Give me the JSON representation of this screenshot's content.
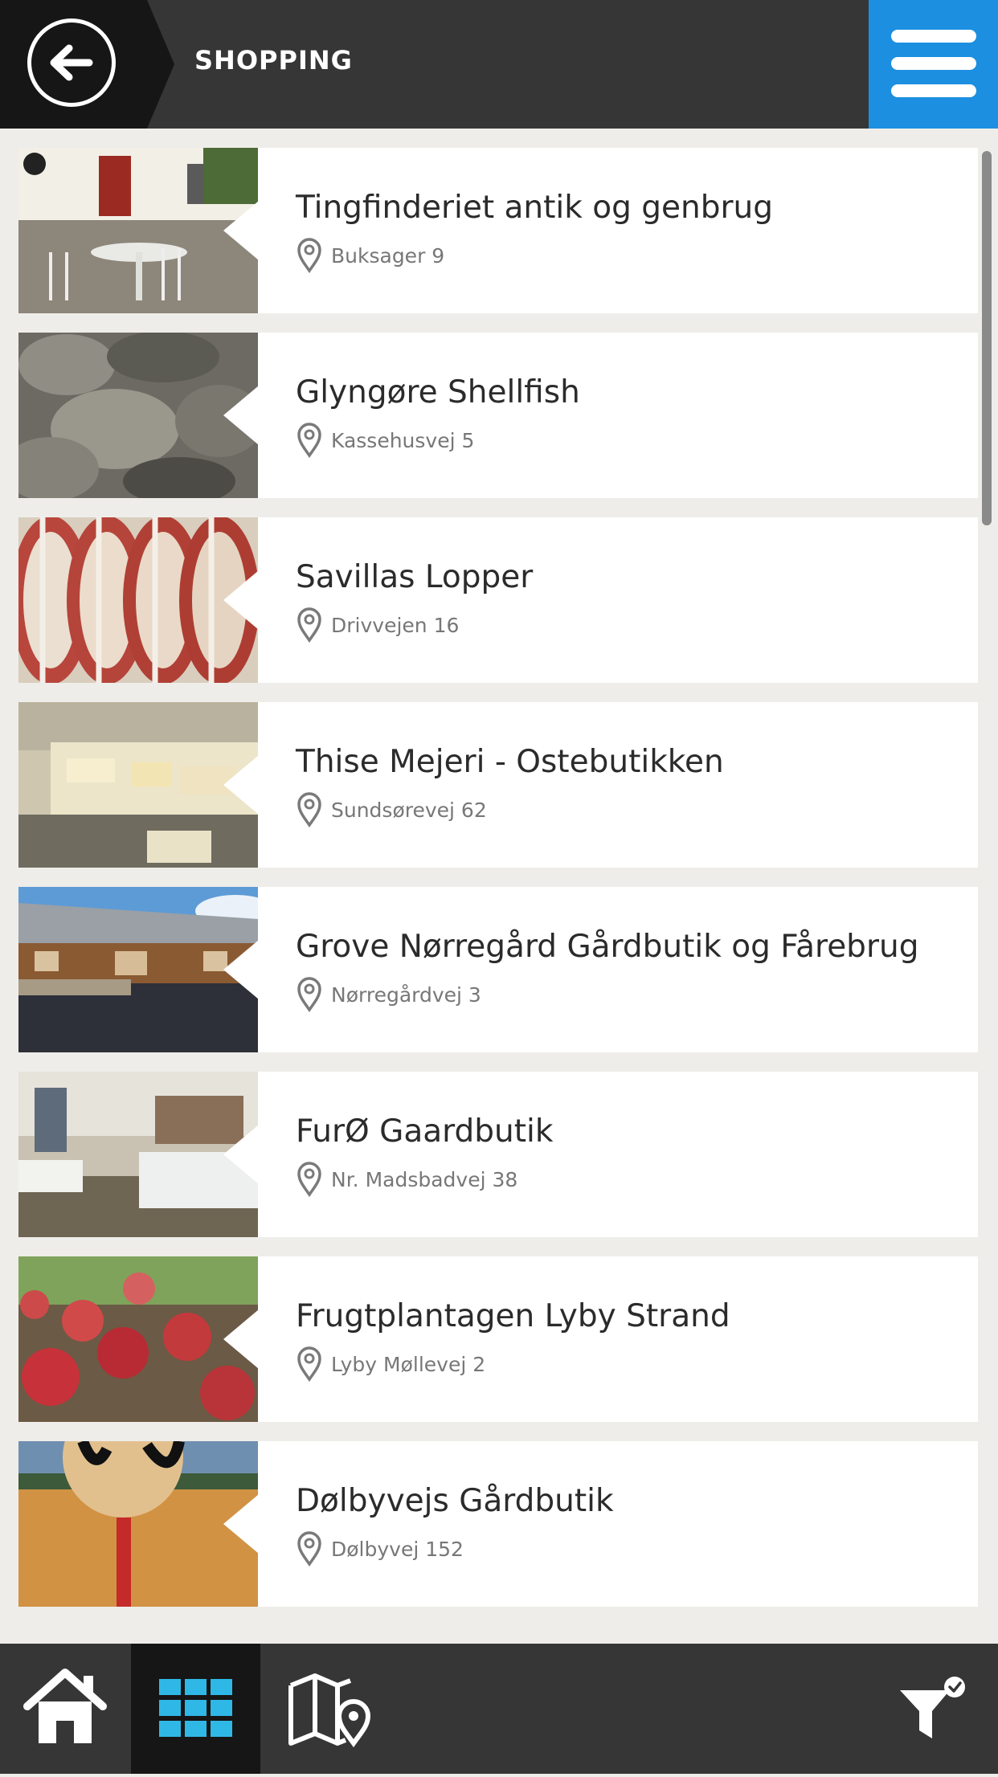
{
  "header": {
    "title": "SHOPPING"
  },
  "items": [
    {
      "name": "Tingfinderiet antik og genbrug",
      "address": "Buksager 9"
    },
    {
      "name": "Glyngøre Shellfish",
      "address": "Kassehusvej 5"
    },
    {
      "name": "Savillas Lopper",
      "address": "Drivvejen 16"
    },
    {
      "name": "Thise Mejeri - Ostebutikken",
      "address": "Sundsørevej 62"
    },
    {
      "name": "Grove Nørregård Gårdbutik og Fårebrug",
      "address": "Nørregårdvej 3"
    },
    {
      "name": "FurØ Gaardbutik",
      "address": "Nr. Madsbadvej 38"
    },
    {
      "name": "Frugtplantagen Lyby Strand",
      "address": "Lyby Møllevej 2"
    },
    {
      "name": "Dølbyvejs Gårdbutik",
      "address": "Dølbyvej 152"
    }
  ],
  "colors": {
    "accent": "#1c8fe1",
    "grid_active": "#2fb8e6",
    "header_bg": "#363636",
    "dark": "#161616"
  },
  "icons": [
    "back-arrow-icon",
    "hamburger-menu-icon",
    "location-pin-icon",
    "home-icon",
    "grid-icon",
    "map-icon",
    "filter-icon"
  ]
}
